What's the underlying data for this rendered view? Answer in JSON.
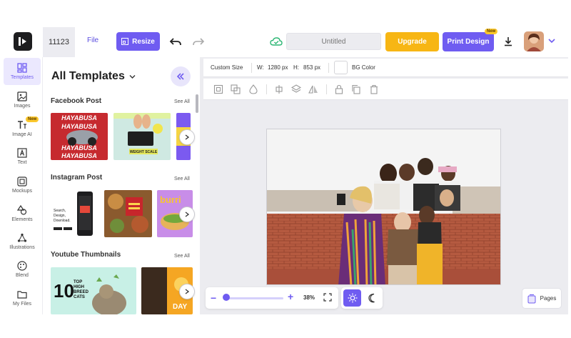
{
  "header": {
    "doc_id": "11123",
    "file_label": "File",
    "resize_label": "Resize",
    "title_placeholder": "Untitled",
    "upgrade_label": "Upgrade",
    "print_label": "Print Design",
    "new_badge": "New"
  },
  "rail": {
    "items": [
      {
        "label": "Templates",
        "icon": "templates-icon"
      },
      {
        "label": "Images",
        "icon": "image-icon"
      },
      {
        "label": "Image AI",
        "icon": "image-ai-icon"
      },
      {
        "label": "Text",
        "icon": "text-icon"
      },
      {
        "label": "Mockups",
        "icon": "mockups-icon"
      },
      {
        "label": "Elements",
        "icon": "elements-icon"
      },
      {
        "label": "Illustrations",
        "icon": "illustrations-icon"
      },
      {
        "label": "Blend",
        "icon": "blend-icon"
      },
      {
        "label": "My Files",
        "icon": "folder-icon"
      }
    ],
    "new_badge": "New"
  },
  "panel": {
    "title": "All Templates",
    "sections": [
      {
        "title": "Facebook Post",
        "see_all": "See All"
      },
      {
        "title": "Instagram Post",
        "see_all": "See All"
      },
      {
        "title": "Youtube Thumbnails",
        "see_all": "See All"
      }
    ],
    "thumb_text": {
      "fb1_line1": "HAYABUSA",
      "fb1_line2": "HAYABUSA",
      "fb1_line3": "HAYABUSA",
      "fb1_line4": "HAYABUSA",
      "fb2_label": "WEIGHT SCALE",
      "ig1_line1": "Search,",
      "ig1_line2": "Design,",
      "ig1_line3": "Download.",
      "ig3_label": "burri",
      "yt1_big": "10",
      "yt1_small1": "TOP",
      "yt1_small2": "HIGH",
      "yt1_small3": "BREED",
      "yt1_small4": "CATS",
      "yt2_label": "DAY"
    }
  },
  "properties": {
    "size_label": "Custom Size",
    "w_label": "W:",
    "w_value": "1280 px",
    "h_label": "H:",
    "h_value": "853 px",
    "bg_label": "BG Color"
  },
  "zoom": {
    "value": "38%",
    "level_fraction": 0.05
  },
  "pages_label": "Pages",
  "colors": {
    "accent": "#6f5cf1",
    "upgrade": "#f7b614",
    "badge": "#fbc82d"
  }
}
